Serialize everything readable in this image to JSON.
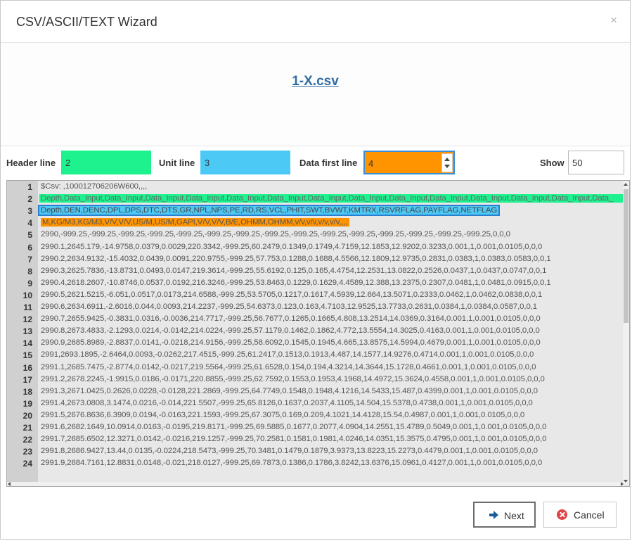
{
  "dialog": {
    "title": "CSV/ASCII/TEXT Wizard",
    "close_glyph": "×",
    "file_name": "1-X.csv"
  },
  "options": {
    "header_label": "Header line",
    "header_value": "2",
    "unit_label": "Unit line",
    "unit_value": "3",
    "data_label": "Data first line",
    "data_value": "4",
    "show_label": "Show",
    "show_value": "50"
  },
  "colors": {
    "header_highlight": "#1df28e",
    "unit_highlight": "#4dc9f5",
    "data_highlight": "#ff9400",
    "link": "#2e6da4"
  },
  "lines": [
    {
      "n": "1",
      "text": "$Csv: ,100012706206W600,,,,"
    },
    {
      "n": "2",
      "text": "Depth,Data_Input,Data_Input,Data_Input,Data_Input,Data_Input,Data_Input,Data_Input,Data_Input,Data_Input,Data_Input,Data_Input,Data_Input,Data_Input,Data_"
    },
    {
      "n": "3",
      "text": "Depth,DEN,DENC,DPL,DPS,DTC,DTS,GR,NPL,NPS,PE,RD,RS,VCL,PHIT,SWT,BVWT,KMTRX,RSVRFLAG,PAYFLAG,NETFLAG"
    },
    {
      "n": "4",
      "text": "M,KG/M3,KG/M3,V/V,V/V,US/M,US/M,GAPI,V/V,V/V,B/E,OHMM,OHMM,v/v,v/v,v/v,v/v,,,,"
    },
    {
      "n": "5",
      "text": "2990,-999.25,-999.25,-999.25,-999.25,-999.25,-999.25,-999.25,-999.25,-999.25,-999.25,-999.25,-999.25,-999.25,-999.25,-999.25,0,0,0"
    },
    {
      "n": "6",
      "text": "2990.1,2645.179,-14.9758,0.0379,0.0029,220.3342,-999.25,60.2479,0.1349,0.1749,4.7159,12.1853,12.9202,0.3233,0.001,1,0.001,0.0105,0,0,0"
    },
    {
      "n": "7",
      "text": "2990.2,2634.9132,-15.4032,0.0439,0.0091,220.9755,-999.25,57.753,0.1288,0.1688,4.5566,12.1809,12.9735,0.2831,0.0383,1,0.0383,0.0583,0,0,1"
    },
    {
      "n": "8",
      "text": "2990.3,2625.7836,-13.8731,0.0493,0.0147,219.3614,-999.25,55.6192,0.125,0.165,4.4754,12.2531,13.0822,0.2526,0.0437,1,0.0437,0.0747,0,0,1"
    },
    {
      "n": "9",
      "text": "2990.4,2618.2607,-10.8746,0.0537,0.0192,216.3246,-999.25,53.8463,0.1229,0.1629,4.4589,12.388,13.2375,0.2307,0.0481,1,0.0481,0.0915,0,0,1"
    },
    {
      "n": "10",
      "text": "2990.5,2621.5215,-6.051,0.0517,0.0173,214.6588,-999.25,53.5705,0.1217,0.1617,4.5939,12.664,13.5071,0.2333,0.0462,1,0.0462,0.0838,0,0,1"
    },
    {
      "n": "11",
      "text": "2990.6,2634.6911,-2.6016,0.044,0.0093,214.2237,-999.25,54.6373,0.123,0.163,4.7103,12.9525,13.7733,0.2631,0.0384,1,0.0384,0.0587,0,0,1"
    },
    {
      "n": "12",
      "text": "2990.7,2655.9425,-0.3831,0.0316,-0.0036,214.7717,-999.25,56.7677,0.1265,0.1665,4.808,13.2514,14.0369,0.3164,0.001,1,0.001,0.0105,0,0,0"
    },
    {
      "n": "13",
      "text": "2990.8,2673.4833,-2.1293,0.0214,-0.0142,214.0224,-999.25,57.1179,0.1462,0.1862,4.772,13.5554,14.3025,0.4163,0.001,1,0.001,0.0105,0,0,0"
    },
    {
      "n": "14",
      "text": "2990.9,2685.8989,-2.8837,0.0141,-0.0218,214.9156,-999.25,58.6092,0.1545,0.1945,4.665,13.8575,14.5994,0.4679,0.001,1,0.001,0.0105,0,0,0"
    },
    {
      "n": "15",
      "text": "2991,2693.1895,-2.6464,0.0093,-0.0262,217.4515,-999.25,61.2417,0.1513,0.1913,4.487,14.1577,14.9276,0.4714,0.001,1,0.001,0.0105,0,0,0"
    },
    {
      "n": "16",
      "text": "2991.1,2685.7475,-2.8774,0.0142,-0.0217,219.5564,-999.25,61.6528,0.154,0.194,4.3214,14.3644,15.1728,0.4661,0.001,1,0.001,0.0105,0,0,0"
    },
    {
      "n": "17",
      "text": "2991.2,2678.2245,-1.9915,0.0186,-0.0171,220.8855,-999.25,62.7592,0.1553,0.1953,4.1968,14.4972,15.3624,0.4558,0.001,1,0.001,0.0105,0,0,0"
    },
    {
      "n": "18",
      "text": "2991.3,2671.0425,0.2626,0.0228,-0.0128,221.2869,-999.25,64.7749,0.1548,0.1948,4.1216,14.5433,15.487,0.4399,0.001,1,0.001,0.0105,0,0,0"
    },
    {
      "n": "19",
      "text": "2991.4,2673.0808,3.1474,0.0216,-0.014,221.5507,-999.25,65.8126,0.1637,0.2037,4.1105,14.504,15.5378,0.4738,0.001,1,0.001,0.0105,0,0,0"
    },
    {
      "n": "20",
      "text": "2991.5,2676.8636,6.3909,0.0194,-0.0163,221.1593,-999.25,67.3075,0.169,0.209,4.1021,14.4128,15.54,0.4987,0.001,1,0.001,0.0105,0,0,0"
    },
    {
      "n": "21",
      "text": "2991.6,2682.1649,10.0914,0.0163,-0.0195,219.8171,-999.25,69.5885,0.1677,0.2077,4.0904,14.2551,15.4789,0.5049,0.001,1,0.001,0.0105,0,0,0"
    },
    {
      "n": "22",
      "text": "2991.7,2685.6502,12.3271,0.0142,-0.0216,219.1257,-999.25,70.2581,0.1581,0.1981,4.0246,14.0351,15.3575,0.4795,0.001,1,0.001,0.0105,0,0,0"
    },
    {
      "n": "23",
      "text": "2991.8,2686.9427,13.44,0.0135,-0.0224,218.5473,-999.25,70.3481,0.1479,0.1879,3.9373,13.8223,15.2273,0.4479,0.001,1,0.001,0.0105,0,0,0"
    },
    {
      "n": "24",
      "text": "2991.9,2684.7161,12.8831,0.0148,-0.021,218.0127,-999.25,69.7873,0.1386,0.1786,3.8242,13.6376,15.0961,0.4127,0.001,1,0.001,0.0105,0,0,0"
    }
  ],
  "buttons": {
    "next_label": "Next",
    "cancel_label": "Cancel",
    "next_icon": "arrow-right-icon",
    "cancel_icon": "cancel-circle-icon"
  }
}
